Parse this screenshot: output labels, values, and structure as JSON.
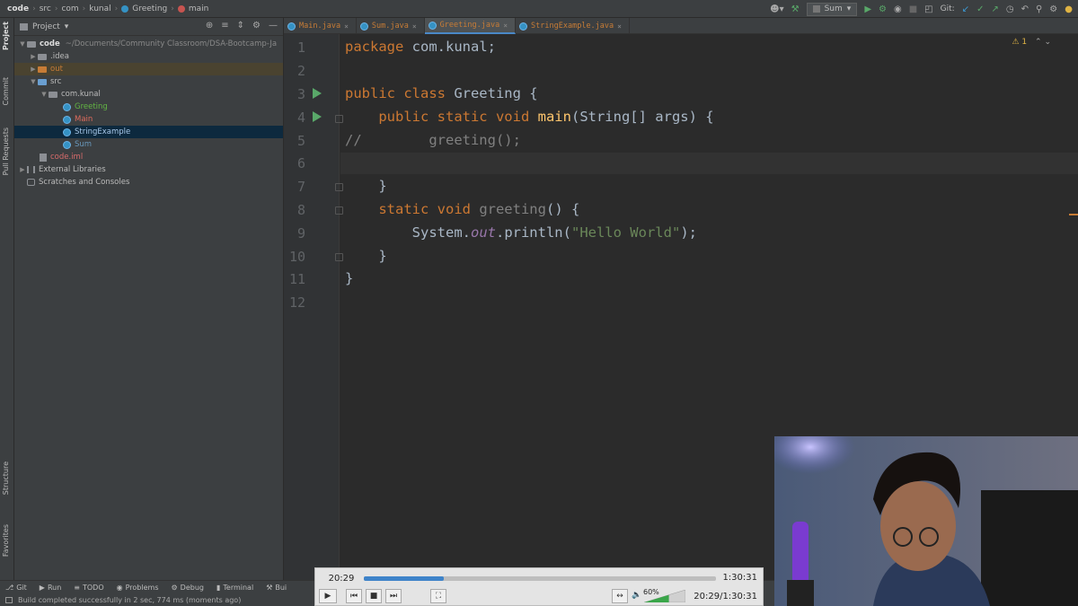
{
  "breadcrumb": {
    "items": [
      "code",
      "src",
      "com",
      "kunal",
      "Greeting",
      "main"
    ]
  },
  "toolbar": {
    "run_config": "Sum",
    "git_label": "Git:"
  },
  "left_strip": {
    "project": "Project",
    "commit": "Commit",
    "pull_requests": "Pull Requests",
    "structure": "Structure",
    "favorites": "Favorites"
  },
  "project_panel": {
    "title": "Project",
    "root_name": "code",
    "root_path": "~/Documents/Community Classroom/DSA-Bootcamp-Ja",
    "idea": ".idea",
    "out": "out",
    "src": "src",
    "package": "com.kunal",
    "files": [
      "Greeting",
      "Main",
      "StringExample",
      "Sum"
    ],
    "iml": "code.iml",
    "external": "External Libraries",
    "scratches": "Scratches and Consoles"
  },
  "editor": {
    "tabs": [
      "Main.java",
      "Sum.java",
      "Greeting.java",
      "StringExample.java"
    ],
    "active_tab": "Greeting.java",
    "warning_count": "1",
    "line_numbers": [
      "1",
      "2",
      "3",
      "4",
      "5",
      "6",
      "7",
      "8",
      "9",
      "10",
      "11",
      "12"
    ],
    "code": {
      "l1_kw": "package",
      "l1_rest": " com.kunal;",
      "l3_kw": "public class",
      "l3_rest": " Greeting {",
      "l4_kw": "    public static void",
      "l4_fn": " main",
      "l4_rest": "(String[] args) {",
      "l5_cm": "//        greeting();",
      "l7": "    }",
      "l8_kw": "    static void",
      "l8_fn": " greeting",
      "l8_rest": "() {",
      "l9_a": "        System.",
      "l9_out": "out",
      "l9_b": ".println(",
      "l9_str": "\"Hello World\"",
      "l9_c": ");",
      "l10": "    }",
      "l11": "}"
    }
  },
  "bottom_tools": [
    "Git",
    "Run",
    "TODO",
    "Problems",
    "Debug",
    "Terminal",
    "Bui"
  ],
  "status": {
    "message": "Build completed successfully in 2 sec, 774 ms (moments ago)"
  },
  "player": {
    "elapsed": "20:29",
    "duration": "1:30:31",
    "position_combined": "20:29/1:30:31",
    "progress": 0.226,
    "volume": "60%"
  }
}
